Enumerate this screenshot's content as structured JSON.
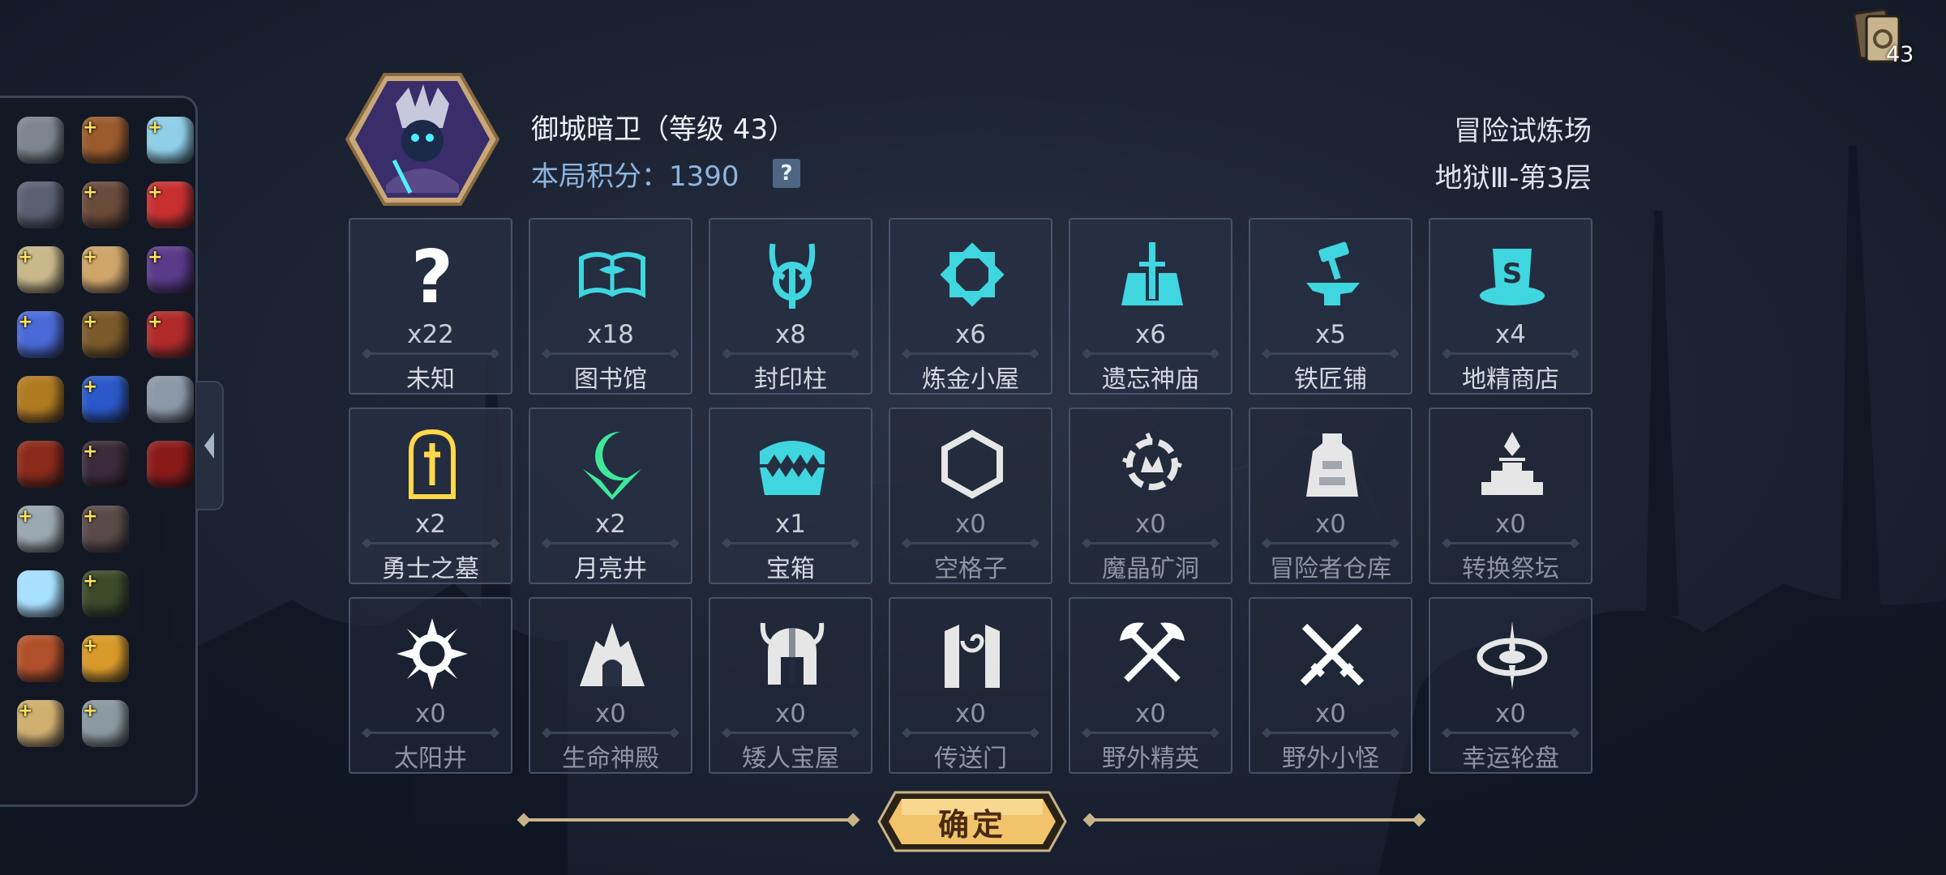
{
  "deck": {
    "count": "43",
    "icon": "card-deck-icon"
  },
  "hero": {
    "name": "御城暗卫（等级 43）",
    "score_line": "本局积分：1390",
    "help_label": "?"
  },
  "mode": {
    "title": "冒险试炼场",
    "level": "地狱Ⅲ-第3层"
  },
  "tiles": [
    {
      "name": "未知",
      "count": "x22",
      "icon": "question-icon",
      "color": "#ffffff"
    },
    {
      "name": "图书馆",
      "count": "x18",
      "icon": "open-book-icon",
      "color": "#3fd6e0"
    },
    {
      "name": "封印柱",
      "count": "x8",
      "icon": "horned-seal-icon",
      "color": "#3fd6e0"
    },
    {
      "name": "炼金小屋",
      "count": "x6",
      "icon": "alchemy-star-icon",
      "color": "#3fd6e0"
    },
    {
      "name": "遗忘神庙",
      "count": "x6",
      "icon": "temple-icon",
      "color": "#3fd6e0"
    },
    {
      "name": "铁匠铺",
      "count": "x5",
      "icon": "anvil-hammer-icon",
      "color": "#3fd6e0"
    },
    {
      "name": "地精商店",
      "count": "x4",
      "icon": "top-hat-icon",
      "color": "#3fd6e0"
    },
    {
      "name": "勇士之墓",
      "count": "x2",
      "icon": "tombstone-icon",
      "color": "#ffd84a"
    },
    {
      "name": "月亮井",
      "count": "x2",
      "icon": "crescent-moon-icon",
      "color": "#3ee89a"
    },
    {
      "name": "宝箱",
      "count": "x1",
      "icon": "mimic-chest-icon",
      "color": "#3fd6e0"
    },
    {
      "name": "空格子",
      "count": "x0",
      "icon": "hexagon-icon",
      "color": "#e6e6e6"
    },
    {
      "name": "魔晶矿洞",
      "count": "x0",
      "icon": "crystal-mine-icon",
      "color": "#e6e6e6"
    },
    {
      "name": "冒险者仓库",
      "count": "x0",
      "icon": "warehouse-icon",
      "color": "#e6e6e6"
    },
    {
      "name": "转换祭坛",
      "count": "x0",
      "icon": "altar-icon",
      "color": "#e6e6e6"
    },
    {
      "name": "太阳井",
      "count": "x0",
      "icon": "sun-icon",
      "color": "#ffffff"
    },
    {
      "name": "生命神殿",
      "count": "x0",
      "icon": "life-shrine-icon",
      "color": "#e6e6e6"
    },
    {
      "name": "矮人宝屋",
      "count": "x0",
      "icon": "dwarf-helmet-icon",
      "color": "#e6e6e6"
    },
    {
      "name": "传送门",
      "count": "x0",
      "icon": "portal-icon",
      "color": "#e6e6e6"
    },
    {
      "name": "野外精英",
      "count": "x0",
      "icon": "crossed-axes-icon",
      "color": "#ffffff"
    },
    {
      "name": "野外小怪",
      "count": "x0",
      "icon": "crossed-swords-icon",
      "color": "#ffffff"
    },
    {
      "name": "幸运轮盘",
      "count": "x0",
      "icon": "wheel-icon",
      "color": "#e6e6e6"
    }
  ],
  "inventory": [
    {
      "icon": "knight-helmet-icon",
      "plus": false,
      "color": "#7c8590"
    },
    {
      "icon": "leather-backpack-icon",
      "plus": true,
      "color": "#9a5a2c"
    },
    {
      "icon": "treasure-chest-icon",
      "plus": true,
      "color": "#8fd0e8"
    },
    {
      "icon": "feathered-hat-icon",
      "plus": false,
      "color": "#5a5f72"
    },
    {
      "icon": "horned-helm-icon",
      "plus": true,
      "color": "#6a4a3a"
    },
    {
      "icon": "red-horn-icon",
      "plus": true,
      "color": "#c83030"
    },
    {
      "icon": "skull-icon",
      "plus": true,
      "color": "#c8b88a"
    },
    {
      "icon": "scroll-map-icon",
      "plus": true,
      "color": "#cfa56a"
    },
    {
      "icon": "shadow-claw-icon",
      "plus": true,
      "color": "#5a3a8a"
    },
    {
      "icon": "horseshoe-magnet-icon",
      "plus": true,
      "color": "#4a6ad8"
    },
    {
      "icon": "armor-vest-icon",
      "plus": true,
      "color": "#7a5a2a"
    },
    {
      "icon": "red-spellbook-icon",
      "plus": true,
      "color": "#b02a2a"
    },
    {
      "icon": "gold-pouch-icon",
      "plus": false,
      "color": "#b07a20"
    },
    {
      "icon": "blue-gem-icon",
      "plus": true,
      "color": "#2a58c8"
    },
    {
      "icon": "war-hammer-icon",
      "plus": false,
      "color": "#8a98a8"
    },
    {
      "icon": "green-tome-icon",
      "plus": false,
      "color": "#8a2a1a"
    },
    {
      "icon": "bat-wing-icon",
      "plus": true,
      "color": "#3a2a3a"
    },
    {
      "icon": "red-leaf-icon",
      "plus": false,
      "color": "#8a1a1a"
    },
    {
      "icon": "stone-rune-icon",
      "plus": true,
      "color": "#9aa8b0"
    },
    {
      "icon": "spiked-collar-icon",
      "plus": true,
      "color": "#5a4a4a"
    },
    {
      "icon": "empty-slot",
      "plus": false,
      "color": ""
    },
    {
      "icon": "diamond-icon",
      "plus": false,
      "color": "#a8e0ff"
    },
    {
      "icon": "poison-cauldron-icon",
      "plus": true,
      "color": "#3a4a2a"
    },
    {
      "icon": "empty-slot",
      "plus": false,
      "color": ""
    },
    {
      "icon": "hooded-cloak-icon",
      "plus": false,
      "color": "#b0502a"
    },
    {
      "icon": "golden-gauntlet-icon",
      "plus": true,
      "color": "#d89a2a"
    },
    {
      "icon": "empty-slot",
      "plus": false,
      "color": ""
    },
    {
      "icon": "old-scroll-icon",
      "plus": true,
      "color": "#d0b070"
    },
    {
      "icon": "stone-tablet-icon",
      "plus": true,
      "color": "#8a9aa0"
    },
    {
      "icon": "empty-slot",
      "plus": false,
      "color": ""
    }
  ],
  "confirm": {
    "label": "确定"
  }
}
